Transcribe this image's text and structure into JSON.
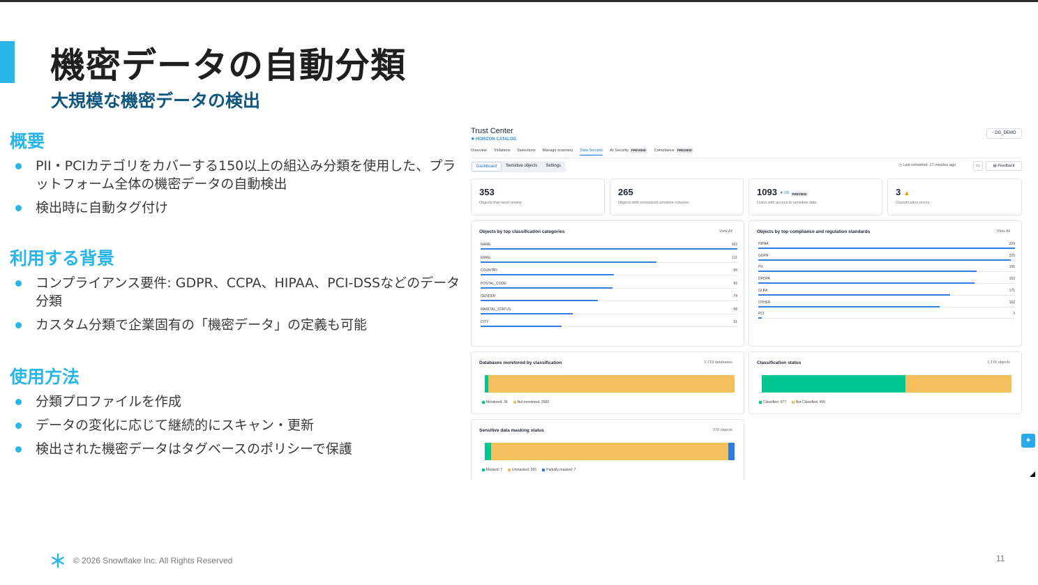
{
  "slide": {
    "title": "機密データの自動分類",
    "subtitle": "大規模な機密データの検出",
    "footer": "© 2026 Snowflake Inc. All Rights Reserved",
    "page_number": "11"
  },
  "sections": [
    {
      "heading": "概要",
      "bullets": [
        "PII・PCIカテゴリをカバーする150以上の組込み分類を使用した、プラットフォーム全体の機密データの自動検出",
        "検出時に自動タグ付け"
      ]
    },
    {
      "heading": "利用する背景",
      "bullets": [
        "コンプライアンス要件: GDPR、CCPA、HIPAA、PCI-DSSなどのデータ分類",
        "カスタム分類で企業固有の「機密データ」の定義も可能"
      ]
    },
    {
      "heading": "使用方法",
      "bullets": [
        "分類プロファイルを作成",
        "データの変化に応じて継続的にスキャン・更新",
        "検出された機密データはタグベースのポリシーで保護"
      ]
    }
  ],
  "screenshot": {
    "app_title": "Trust Center",
    "brand": "HORIZON CATALOG",
    "db_selector": "DG_DEMO",
    "nav_tabs": [
      "Overview",
      "Violations",
      "Detections",
      "Manage scanners",
      "Data Security",
      "AI Security",
      "Compliance"
    ],
    "nav_active": "Data Security",
    "preview_badge": "PREVIEW",
    "sub_tabs": [
      "Dashboard",
      "Sensitive objects",
      "Settings"
    ],
    "last_refreshed": "Last refreshed: 17 minutes ago",
    "feedback": "Feedback",
    "kpis": [
      {
        "value": "353",
        "label": "Objects that need review"
      },
      {
        "value": "265",
        "label": "Objects with unmasked sensitive columns"
      },
      {
        "value": "1093",
        "label": "Users with access to sensitive data",
        "change": "▼ 1%"
      },
      {
        "value": "3",
        "label": "Classification errors"
      }
    ],
    "view_all": "View All",
    "categories_card": {
      "title": "Objects by top classification categories",
      "rows": [
        {
          "label": "NAME",
          "value": 162
        },
        {
          "label": "EMAIL",
          "value": 111
        },
        {
          "label": "COUNTRY",
          "value": 84
        },
        {
          "label": "POSTAL_CODE",
          "value": 83
        },
        {
          "label": "GENDER",
          "value": 74
        },
        {
          "label": "MARITAL_STATUS",
          "value": 58
        },
        {
          "label": "CITY",
          "value": 51
        }
      ]
    },
    "compliance_card": {
      "title": "Objects by top compliance and regulation standards",
      "rows": [
        {
          "label": "HIPAA",
          "value": 229
        },
        {
          "label": "GDPR",
          "value": 225
        },
        {
          "label": "PII",
          "value": 195
        },
        {
          "label": "DPDPA",
          "value": 193
        },
        {
          "label": "GLBA",
          "value": 171
        },
        {
          "label": "OTHER",
          "value": 162
        },
        {
          "label": "PCI",
          "value": 3
        }
      ]
    },
    "databases_card": {
      "title": "Databases monitored by classification",
      "total": "2,719 databases",
      "legend": [
        "Monitored: 36",
        "Not monitored: 2683"
      ],
      "values": [
        36,
        2683
      ]
    },
    "classification_card": {
      "title": "Classification status",
      "total": "1,176 objects",
      "legend": [
        "Classified: 677",
        "Not Classified: 499"
      ],
      "values": [
        677,
        499
      ]
    },
    "masking_card": {
      "title": "Sensitive data masking status",
      "total": "279 objects",
      "legend": [
        "Masked: 7",
        "Unmasked: 265",
        "Partially masked: 7"
      ],
      "values": [
        7,
        265,
        7
      ]
    }
  },
  "colors": {
    "accent": "#29b5e8",
    "subtitle": "#11567f",
    "bar_blue": "#2f7de0",
    "green": "#00c792",
    "yellow": "#f3c05b"
  }
}
